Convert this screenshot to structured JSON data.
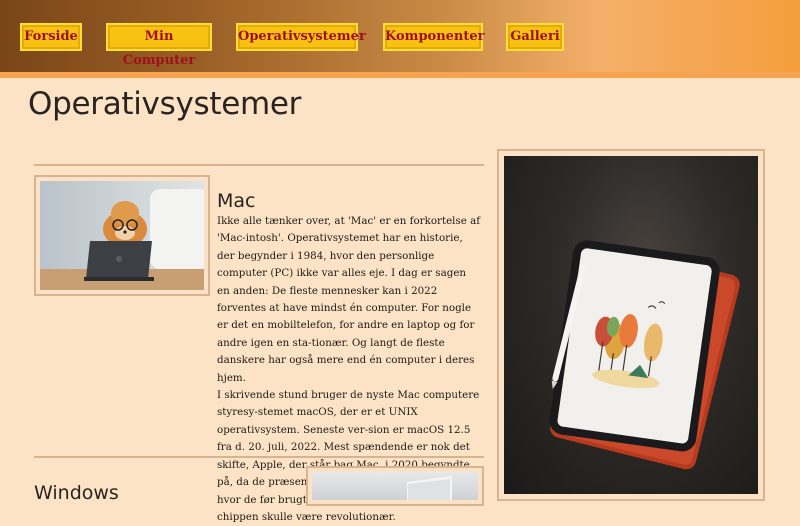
{
  "nav": {
    "items": [
      {
        "label": "Forside"
      },
      {
        "label": "Min Computer"
      },
      {
        "label": "Operativsystemer"
      },
      {
        "label": "Komponenter"
      },
      {
        "label": "Galleri"
      }
    ]
  },
  "page": {
    "title": "Operativsystemer"
  },
  "mac": {
    "title": "Mac",
    "paragraphs": [
      "Ikke alle tænker over, at 'Mac' er en forkortelse af 'Mac-intosh'. Operativsystemet har en historie, der begynder i 1984, hvor den personlige computer (PC) ikke var alles eje. I dag er sagen en anden: De fleste mennesker kan i 2022 forventes at have mindst én computer. For nogle er det en mobiltelefon, for andre en laptop og for andre igen en sta-tionær. Og langt de fleste danskere har også mere end én computer i deres hjem.",
      "I skrivende stund bruger de nyste Mac computere styresy-stemet macOS, der er et UNIX operativsystem. Seneste ver-sion er macOS 12.5 fra d. 20. juli, 2022. Mest spændende er nok det skifte, Apple, der står bag Mac, i 2020 begyndte på, da de præsenterede Apple M1 processoren, hvor de før brugte Intel Core processorer. M1 chippen skulle være revolutionær."
    ]
  },
  "windows": {
    "title": "Windows"
  }
}
